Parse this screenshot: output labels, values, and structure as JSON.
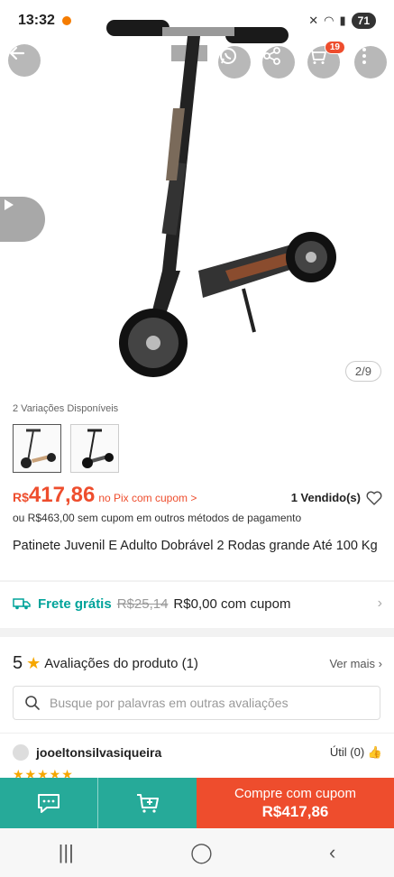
{
  "status": {
    "time": "13:32",
    "battery": "71"
  },
  "gallery": {
    "counter": "2/9",
    "cart_badge": "19"
  },
  "variations": {
    "label": "2 Variações Disponíveis"
  },
  "price": {
    "currency": "R$",
    "value": "417,86",
    "pix_label": "no Pix com cupom >",
    "sold": "1 Vendido(s)",
    "alt_price_text": "ou R$463,00 sem cupom em outros métodos de pagamento"
  },
  "product": {
    "title": "Patinete Juvenil E Adulto Dobrável 2 Rodas grande Até 100 Kg"
  },
  "shipping": {
    "free_label": "Frete grátis",
    "old_price": "R$25,14",
    "new_price": "R$0,00 com cupom"
  },
  "reviews": {
    "rating": "5",
    "title": "Avaliações do produto (1)",
    "see_more": "Ver mais",
    "search_placeholder": "Busque por palavras em outras avaliações",
    "username": "jooeltonsilvasiqueira",
    "useful": "Útil (0)",
    "stars": "★★★★★"
  },
  "bottom": {
    "buy_line1": "Compre com cupom",
    "buy_line2": "R$417,86"
  },
  "colors": {
    "accent": "#ee4d2d",
    "teal": "#26aa99",
    "shipping": "#00a39a",
    "star": "#f6a700"
  },
  "icons": [
    "back-arrow-icon",
    "whatsapp-icon",
    "share-icon",
    "cart-icon",
    "more-icon",
    "play-icon",
    "heart-icon",
    "truck-icon",
    "star-icon",
    "search-icon",
    "thumbs-up-icon",
    "chat-icon",
    "add-to-cart-icon"
  ]
}
